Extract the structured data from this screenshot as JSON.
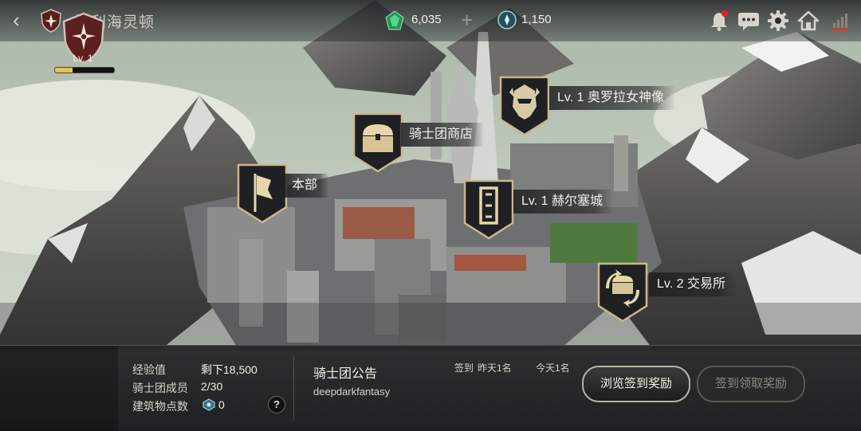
{
  "header": {
    "back_glyph": "‹",
    "title": "比利海灵顿",
    "gems": "6,035",
    "plus_glyph": "+",
    "coins": "1,150",
    "icons": [
      "bell-icon",
      "chat-icon",
      "gear-icon",
      "home-icon",
      "signal-icon"
    ]
  },
  "buildings": [
    {
      "label": "本部",
      "icon": "banner-icon"
    },
    {
      "label": "骑士团商店",
      "icon": "chest-icon"
    },
    {
      "label": "Lv. 1  奥罗拉女神像",
      "icon": "helm-icon"
    },
    {
      "label": "Lv. 1  赫尔塞城",
      "icon": "tower-icon"
    },
    {
      "label": "Lv. 2  交易所",
      "icon": "exchange-icon"
    }
  ],
  "guild": {
    "level": "Lv. 1",
    "xp_progress": 0.3,
    "stats": [
      {
        "key": "经验值",
        "value": "剩下18,500"
      },
      {
        "key": "骑士团成员",
        "value": "2/30"
      },
      {
        "key": "建筑物点数",
        "value": "0"
      }
    ],
    "help": "?"
  },
  "notice": {
    "title": "骑士团公告",
    "body": "deepdarkfantasy"
  },
  "checkin": {
    "label": "签到",
    "yesterday": "昨天1名",
    "today": "今天1名"
  },
  "buttons": {
    "browse": "浏览签到奖励",
    "claim": "签到领取奖励"
  },
  "colors": {
    "accent_gold": "#e7c24a",
    "gem_green": "#3fbf7a",
    "notification_red": "#e0222a"
  }
}
